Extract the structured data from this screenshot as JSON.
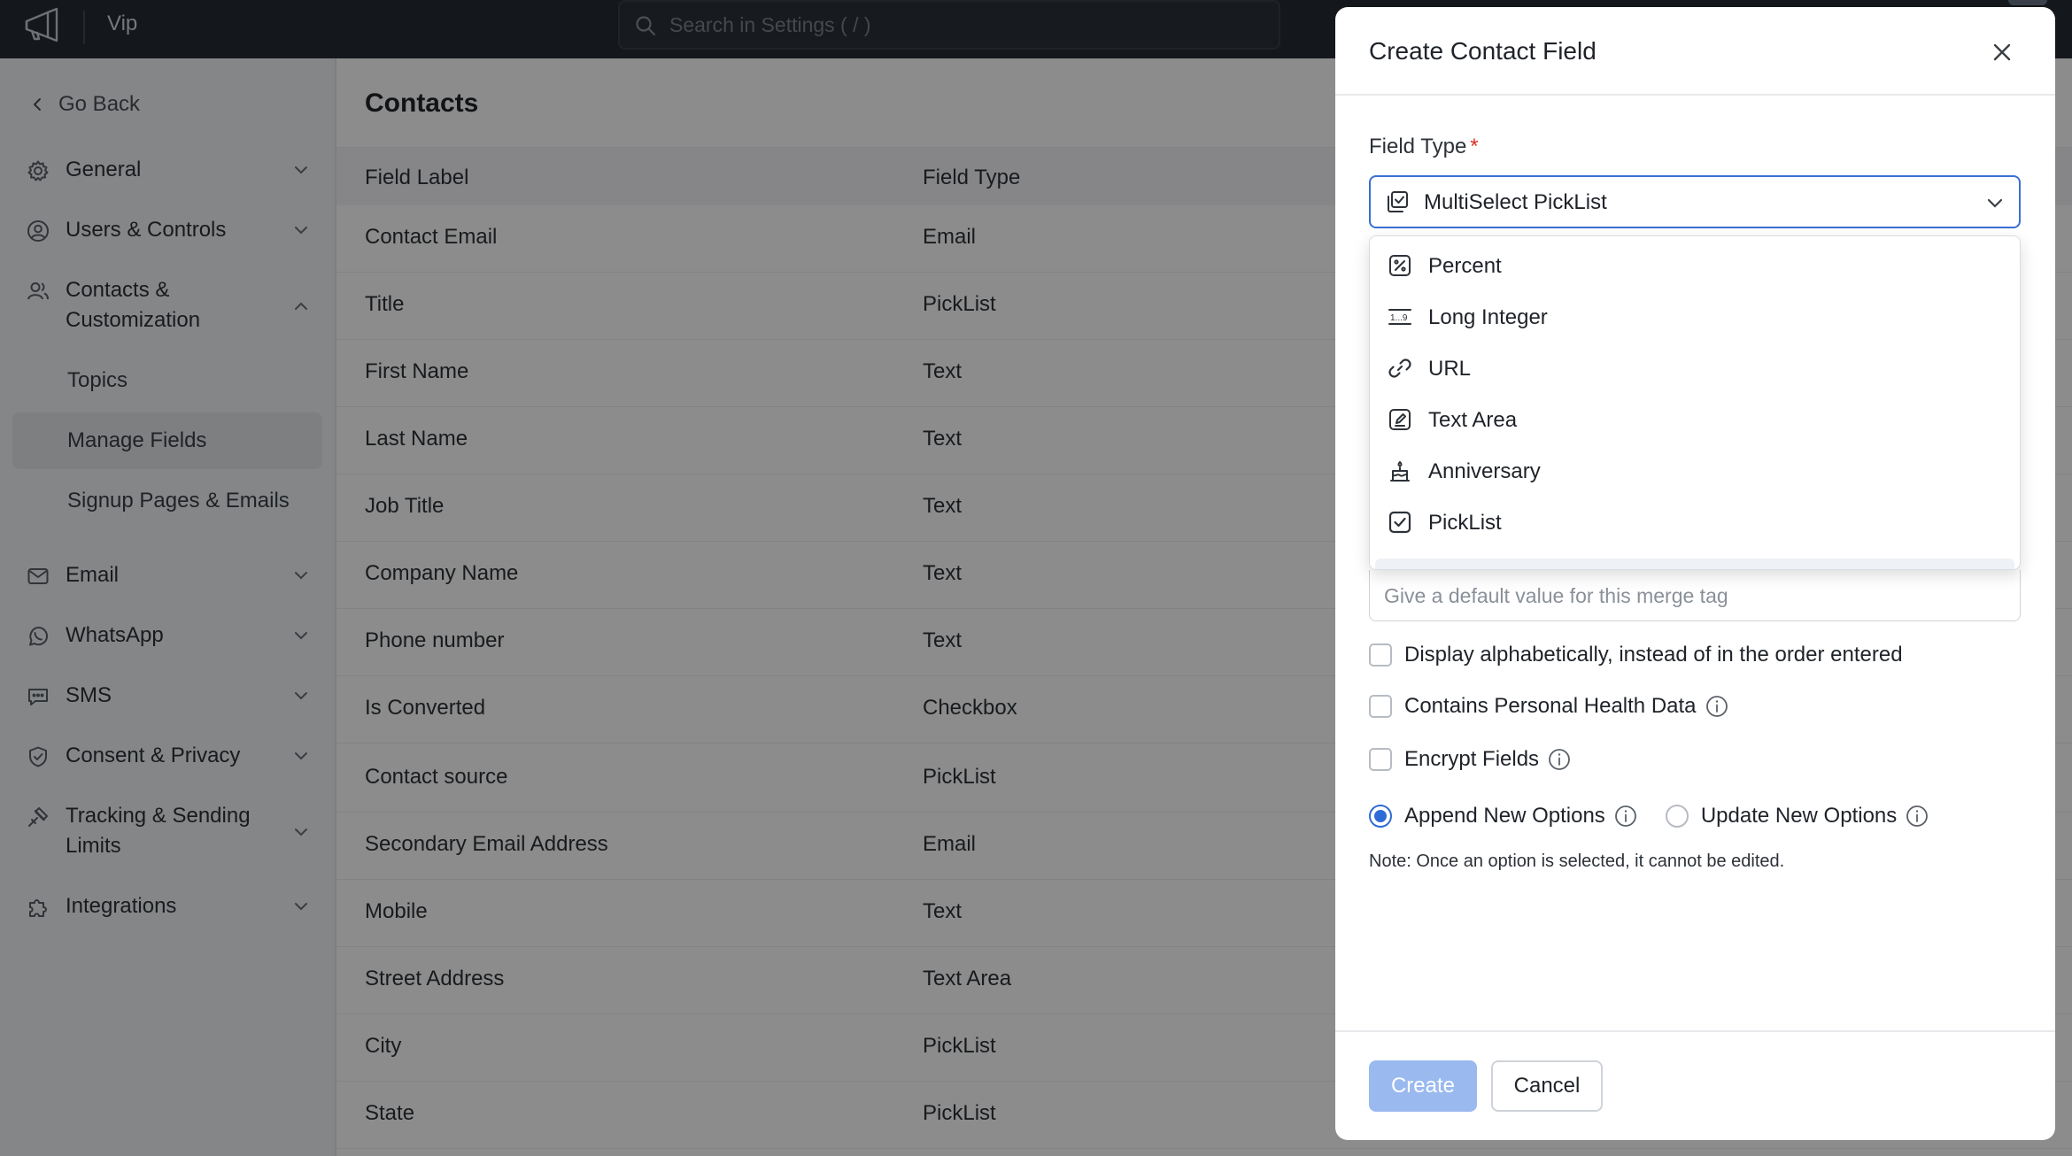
{
  "topbar": {
    "org_name": "Vip",
    "search_placeholder": "Search in Settings ( / )"
  },
  "sidebar": {
    "back_label": "Go Back",
    "items": [
      {
        "label": "General",
        "icon": "gear-icon"
      },
      {
        "label": "Users & Controls",
        "icon": "user-circle-icon"
      },
      {
        "label": "Contacts & Customization",
        "icon": "contacts-icon"
      },
      {
        "label": "Email",
        "icon": "mail-icon"
      },
      {
        "label": "WhatsApp",
        "icon": "whatsapp-icon"
      },
      {
        "label": "SMS",
        "icon": "sms-icon"
      },
      {
        "label": "Consent & Privacy",
        "icon": "shield-icon"
      },
      {
        "label": "Tracking & Sending Limits",
        "icon": "tracking-icon"
      },
      {
        "label": "Integrations",
        "icon": "puzzle-icon"
      }
    ],
    "sub_items": [
      "Topics",
      "Manage Fields",
      "Signup Pages & Emails"
    ],
    "active_sub_item": "Manage Fields"
  },
  "main": {
    "title": "Contacts",
    "columns": [
      "Field Label",
      "Field Type"
    ],
    "rows": [
      [
        "Contact Email",
        "Email"
      ],
      [
        "Title",
        "PickList"
      ],
      [
        "First Name",
        "Text"
      ],
      [
        "Last Name",
        "Text"
      ],
      [
        "Job Title",
        "Text"
      ],
      [
        "Company Name",
        "Text"
      ],
      [
        "Phone number",
        "Text"
      ],
      [
        "Is Converted",
        "Checkbox"
      ],
      [
        "Contact source",
        "PickList"
      ],
      [
        "Secondary Email Address",
        "Email"
      ],
      [
        "Mobile",
        "Text"
      ],
      [
        "Street Address",
        "Text Area"
      ],
      [
        "City",
        "PickList"
      ],
      [
        "State",
        "PickList"
      ]
    ]
  },
  "modal": {
    "title": "Create Contact Field",
    "field_type_label": "Field Type",
    "required_mark": "*",
    "selected_type": "MultiSelect PickList",
    "dropdown_options": [
      {
        "label": "Percent",
        "icon": "percent-icon"
      },
      {
        "label": "Long Integer",
        "icon": "long-integer-icon"
      },
      {
        "label": "URL",
        "icon": "link-icon"
      },
      {
        "label": "Text Area",
        "icon": "text-area-icon"
      },
      {
        "label": "Anniversary",
        "icon": "cake-icon"
      },
      {
        "label": "PickList",
        "icon": "checkbox-icon"
      }
    ],
    "default_value_placeholder": "Give a default value for this merge tag",
    "checkboxes": [
      {
        "label": "Display alphabetically, instead of in the order entered",
        "checked": false,
        "info": false
      },
      {
        "label": "Contains Personal Health Data",
        "checked": false,
        "info": true
      },
      {
        "label": "Encrypt Fields",
        "checked": false,
        "info": true
      }
    ],
    "radio_options": [
      {
        "label": "Append New Options",
        "selected": true
      },
      {
        "label": "Update New Options",
        "selected": false
      }
    ],
    "note": "Note: Once an option is selected, it cannot be edited.",
    "create_label": "Create",
    "cancel_label": "Cancel"
  },
  "colors": {
    "accent": "#2f6bd6",
    "topbar_bg": "#262b33",
    "create_disabled": "#9ab9ef",
    "required": "#d93025"
  }
}
